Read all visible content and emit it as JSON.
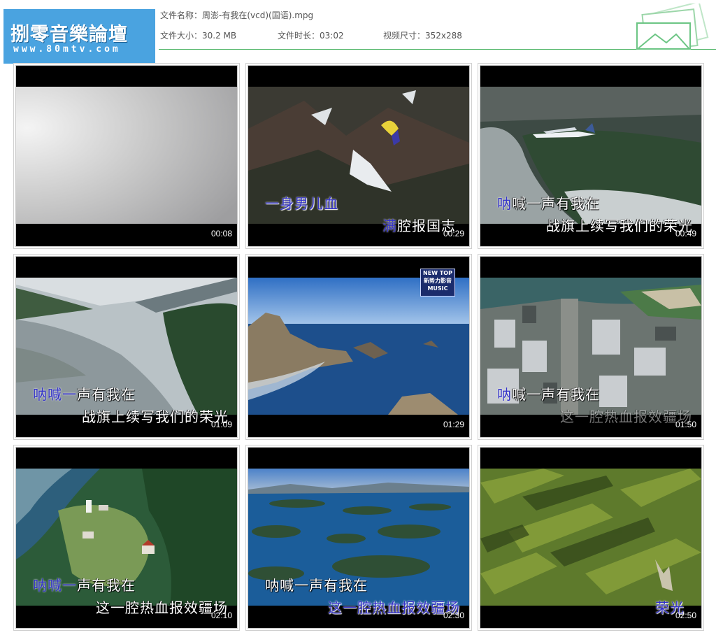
{
  "logo": {
    "title": "捌零音樂論壇",
    "url": "www.80mtv.com"
  },
  "file": {
    "name_label": "文件名称：",
    "name": "周澎-有我在(vcd)(国语).mpg",
    "size_label": "文件大小：",
    "size": "30.2 MB",
    "duration_label": "文件时长：",
    "duration": "03:02",
    "dims_label": "视频尺寸：",
    "dims": "352x288"
  },
  "colors": {
    "logo_bg": "#4aa3e0",
    "rule": "#43b05c",
    "subtitle_highlight": "#3433c8"
  },
  "thumbnails": [
    {
      "time": "00:08",
      "scene": "fog-sky",
      "lines": []
    },
    {
      "time": "00:29",
      "scene": "mountain-paraglider",
      "lines": [
        {
          "text": "一身男儿血",
          "style": "blue"
        },
        {
          "pre": "满",
          "text": "腔报国志",
          "style": "partial"
        }
      ]
    },
    {
      "time": "00:49",
      "scene": "river-seaplane",
      "lines": [
        {
          "pre": "呐",
          "text": "喊一声有我在",
          "style": "partial"
        },
        {
          "text": "战旗上续写我们的荣光",
          "style": "white"
        }
      ]
    },
    {
      "time": "01:09",
      "scene": "lake-forest",
      "lines": [
        {
          "pre": "呐喊一",
          "text": "声有我在",
          "style": "partial"
        },
        {
          "text": "战旗上续写我们的荣光",
          "style": "white"
        }
      ]
    },
    {
      "time": "01:29",
      "scene": "coast-rocks",
      "badge": [
        "NEW TOP",
        "新势力影音",
        "MUSIC"
      ],
      "lines": []
    },
    {
      "time": "01:50",
      "scene": "city-aerial",
      "lines": [
        {
          "pre": "呐",
          "text": "喊一声有我在",
          "style": "partial"
        },
        {
          "text": "这一腔热血报效疆场",
          "style": "dim"
        }
      ]
    },
    {
      "time": "02:10",
      "scene": "island-lighthouse",
      "lines": [
        {
          "pre": "呐喊一",
          "text": "声有我在",
          "style": "partial"
        },
        {
          "text": "这一腔热血报效疆场",
          "style": "white"
        }
      ]
    },
    {
      "time": "02:30",
      "scene": "archipelago",
      "lines": [
        {
          "text": "呐喊一声有我在",
          "style": "white"
        },
        {
          "text": "这一腔热血报效疆场",
          "style": "blue"
        }
      ]
    },
    {
      "time": "02:50",
      "scene": "forest-blur",
      "lines": [
        {
          "text": "荣光",
          "style": "blue"
        }
      ]
    }
  ]
}
